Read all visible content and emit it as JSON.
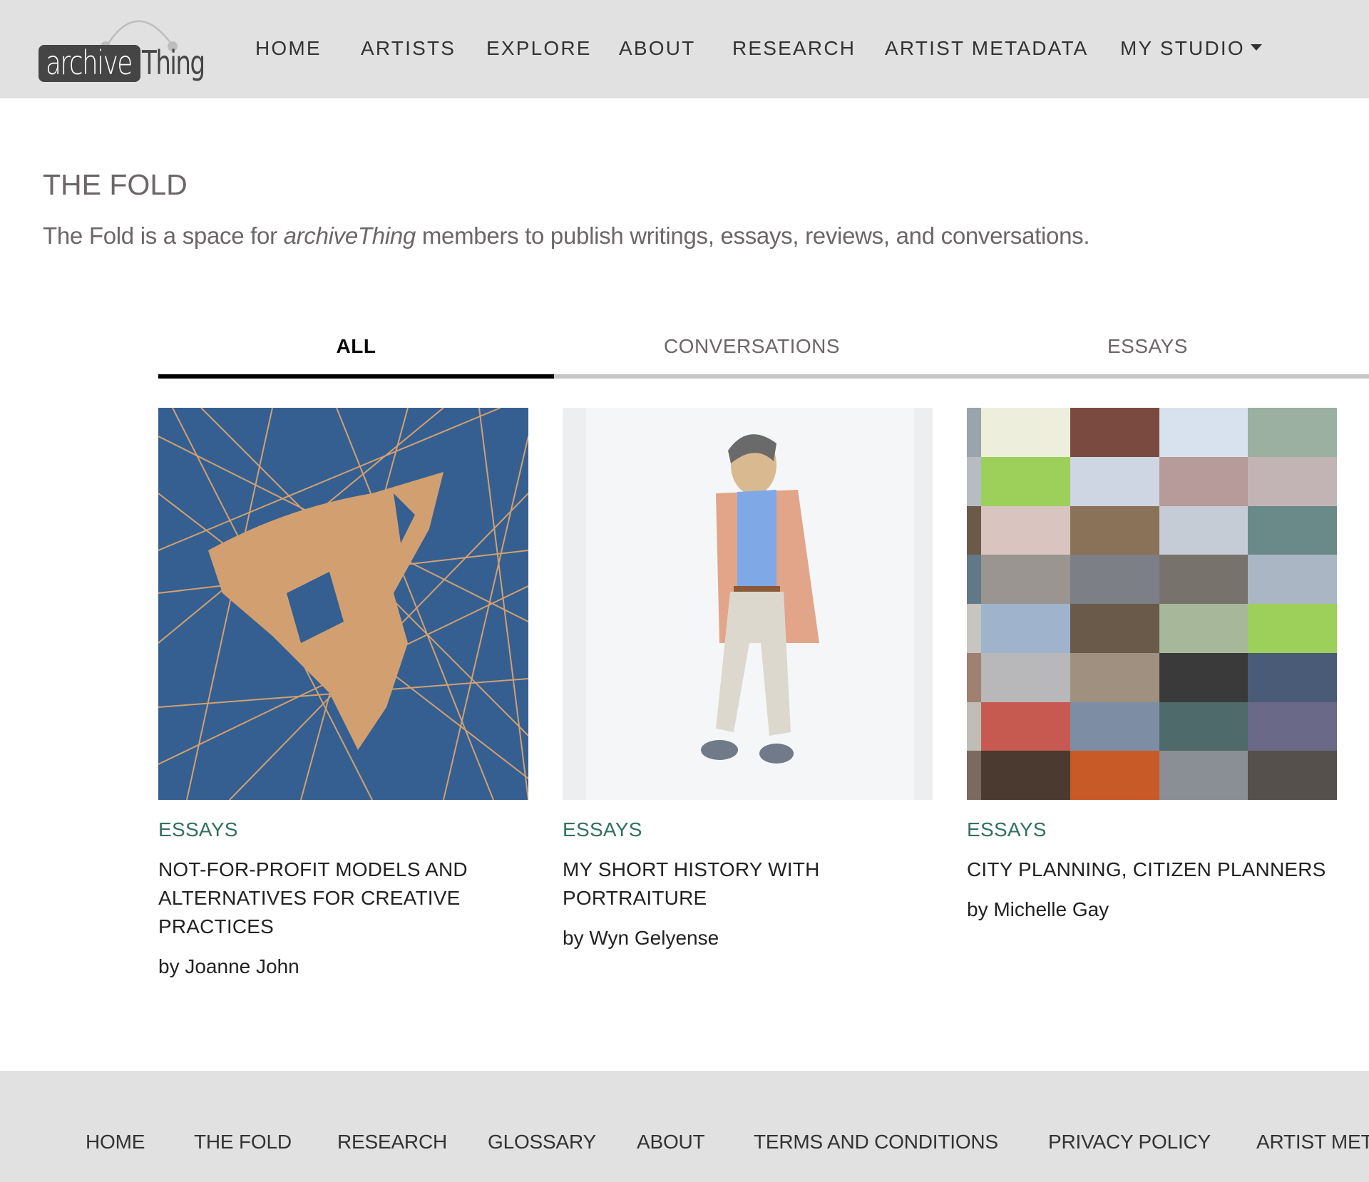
{
  "brand": {
    "logo_part1": "archive",
    "logo_part2": "Thing"
  },
  "nav": {
    "items": [
      {
        "label": "HOME"
      },
      {
        "label": "ARTISTS"
      },
      {
        "label": "EXPLORE"
      },
      {
        "label": "ABOUT"
      },
      {
        "label": "RESEARCH"
      },
      {
        "label": "ARTIST METADATA"
      },
      {
        "label": "MY STUDIO",
        "has_dropdown": true
      }
    ]
  },
  "page": {
    "title": "THE FOLD",
    "intro_before": "The Fold is a space for ",
    "intro_em": "archiveThing",
    "intro_after": " members to publish writings, essays, reviews, and conversations."
  },
  "tabs": [
    {
      "label": "ALL",
      "active": true
    },
    {
      "label": "CONVERSATIONS",
      "active": false
    },
    {
      "label": "ESSAYS",
      "active": false
    }
  ],
  "cards": [
    {
      "category": "ESSAYS",
      "title": "NOT-FOR-PROFIT MODELS AND ALTERNATIVES FOR CREATIVE PRACTICES",
      "author": "by Joanne John",
      "image": "abstract-blue-orange-artwork"
    },
    {
      "category": "ESSAYS",
      "title": "MY SHORT HISTORY WITH PORTRAITURE",
      "author": "by Wyn Gelyense",
      "image": "watercolor-portrait"
    },
    {
      "category": "ESSAYS",
      "title": "CITY PLANNING, CITIZEN PLANNERS",
      "author": "by Michelle Gay",
      "image": "city-photo-collage"
    }
  ],
  "footer": {
    "items": [
      {
        "label": "HOME"
      },
      {
        "label": "THE FOLD"
      },
      {
        "label": "RESEARCH"
      },
      {
        "label": "GLOSSARY"
      },
      {
        "label": "ABOUT"
      },
      {
        "label": "TERMS AND CONDITIONS"
      },
      {
        "label": "PRIVACY POLICY"
      },
      {
        "label": "ARTIST METADATA"
      }
    ]
  },
  "colors": {
    "header_bg": "#e1e1e1",
    "category_accent": "#34705f",
    "tab_active": "#000000",
    "tab_track": "#c6c6c6"
  }
}
